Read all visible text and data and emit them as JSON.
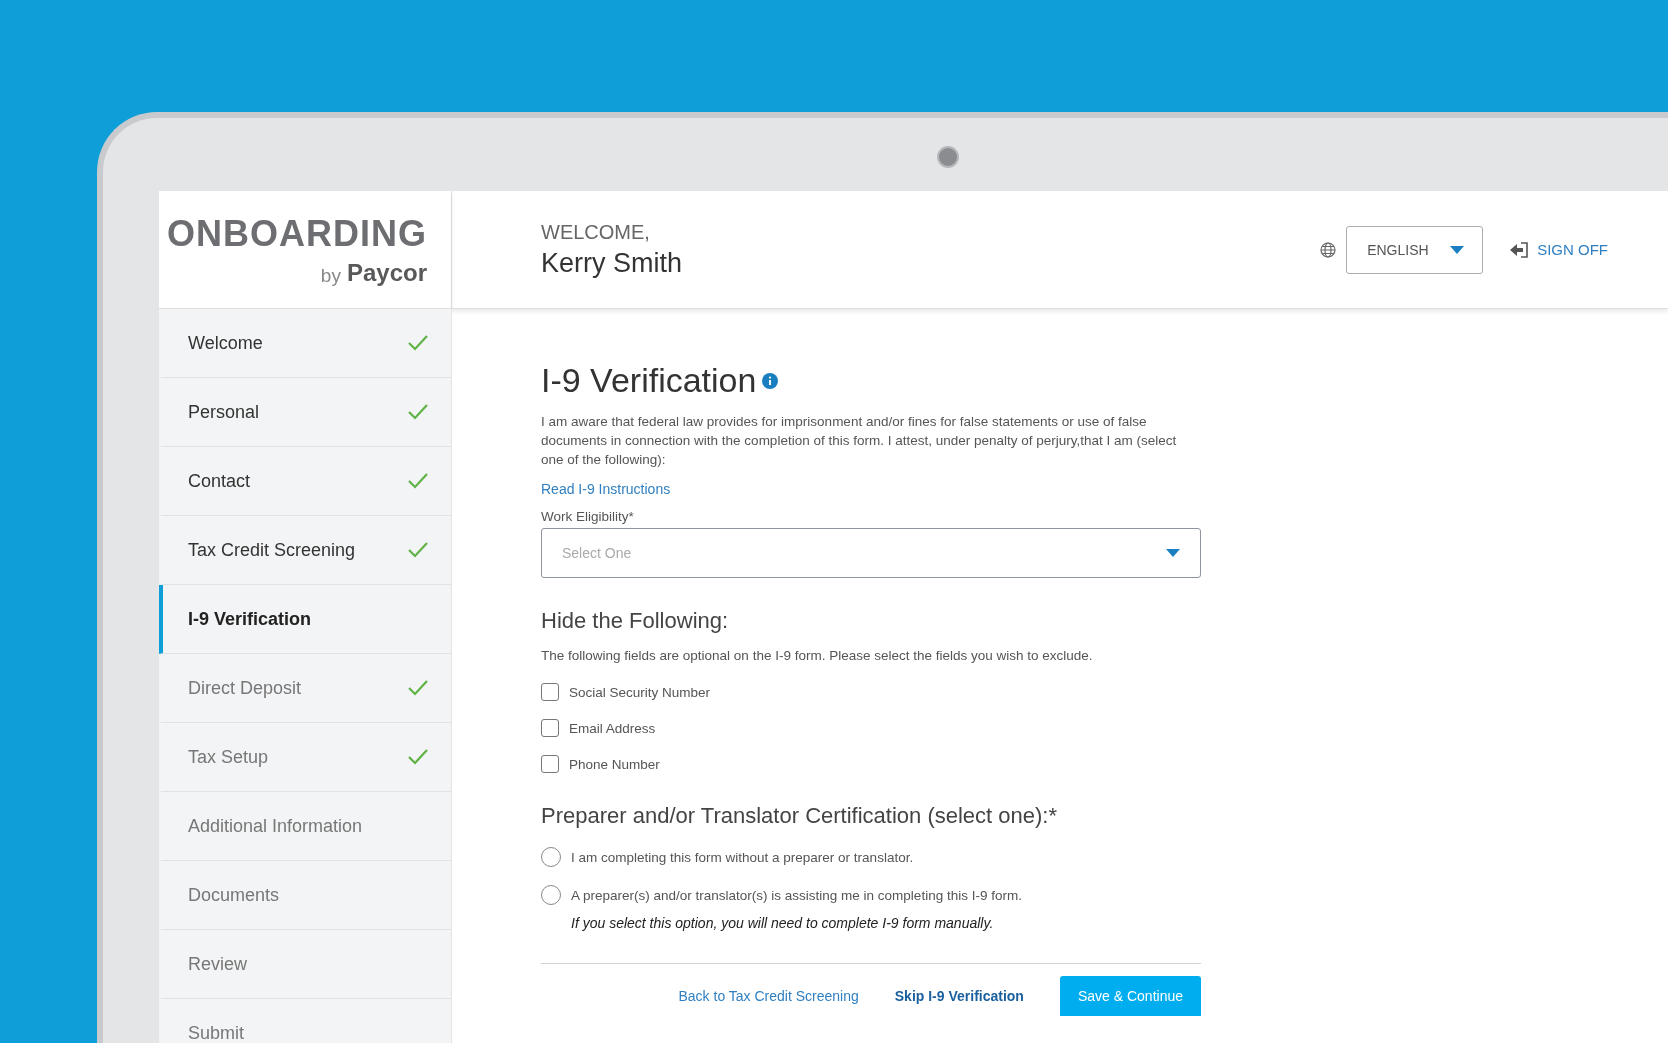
{
  "brand": {
    "title": "ONBOARDING",
    "by": "by",
    "company": "Paycor"
  },
  "header": {
    "greeting": "WELCOME,",
    "name": "Kerry Smith",
    "language": "ENGLISH",
    "sign_off": "SIGN OFF"
  },
  "sidebar": {
    "items": [
      {
        "label": "Welcome",
        "done": true,
        "selected": false
      },
      {
        "label": "Personal",
        "done": true,
        "selected": false
      },
      {
        "label": "Contact",
        "done": true,
        "selected": false
      },
      {
        "label": "Tax Credit Screening",
        "done": true,
        "selected": false
      },
      {
        "label": "I-9 Verification",
        "done": false,
        "selected": true
      },
      {
        "label": "Direct Deposit",
        "done": true,
        "selected": false
      },
      {
        "label": "Tax Setup",
        "done": true,
        "selected": false
      },
      {
        "label": "Additional Information",
        "done": false,
        "selected": false
      },
      {
        "label": "Documents",
        "done": false,
        "selected": false
      },
      {
        "label": "Review",
        "done": false,
        "selected": false
      },
      {
        "label": "Submit",
        "done": false,
        "selected": false
      }
    ]
  },
  "form": {
    "title": "I-9 Verification",
    "intro": "I am aware that federal law provides for imprisonment and/or fines for false statements or use of false documents in connection with the completion of this form. I attest, under penalty of perjury,that I am (select one of the following):",
    "instructions_link": "Read I-9 Instructions",
    "eligibility": {
      "label": "Work Eligibility*",
      "placeholder": "Select One"
    },
    "hide_heading": "Hide the Following:",
    "hide_note": "The following fields are optional on the I-9 form. Please select the fields you wish to exclude.",
    "hide_options": [
      {
        "label": "Social Security Number",
        "checked": false
      },
      {
        "label": "Email Address",
        "checked": false
      },
      {
        "label": "Phone Number",
        "checked": false
      }
    ],
    "preparer_heading": "Preparer and/or Translator Certification (select one):*",
    "preparer_options": [
      {
        "label": "I am completing this form without a preparer or translator.",
        "selected": false
      },
      {
        "label": "A preparer(s) and/or translator(s) is assisting me in completing this I-9 form.",
        "selected": false
      }
    ],
    "preparer_note": "If you select this option, you will need to complete I-9 form manually.",
    "back_link": "Back to Tax Credit Screening",
    "skip_link": "Skip I-9 Verification",
    "save_button": "Save & Continue"
  }
}
